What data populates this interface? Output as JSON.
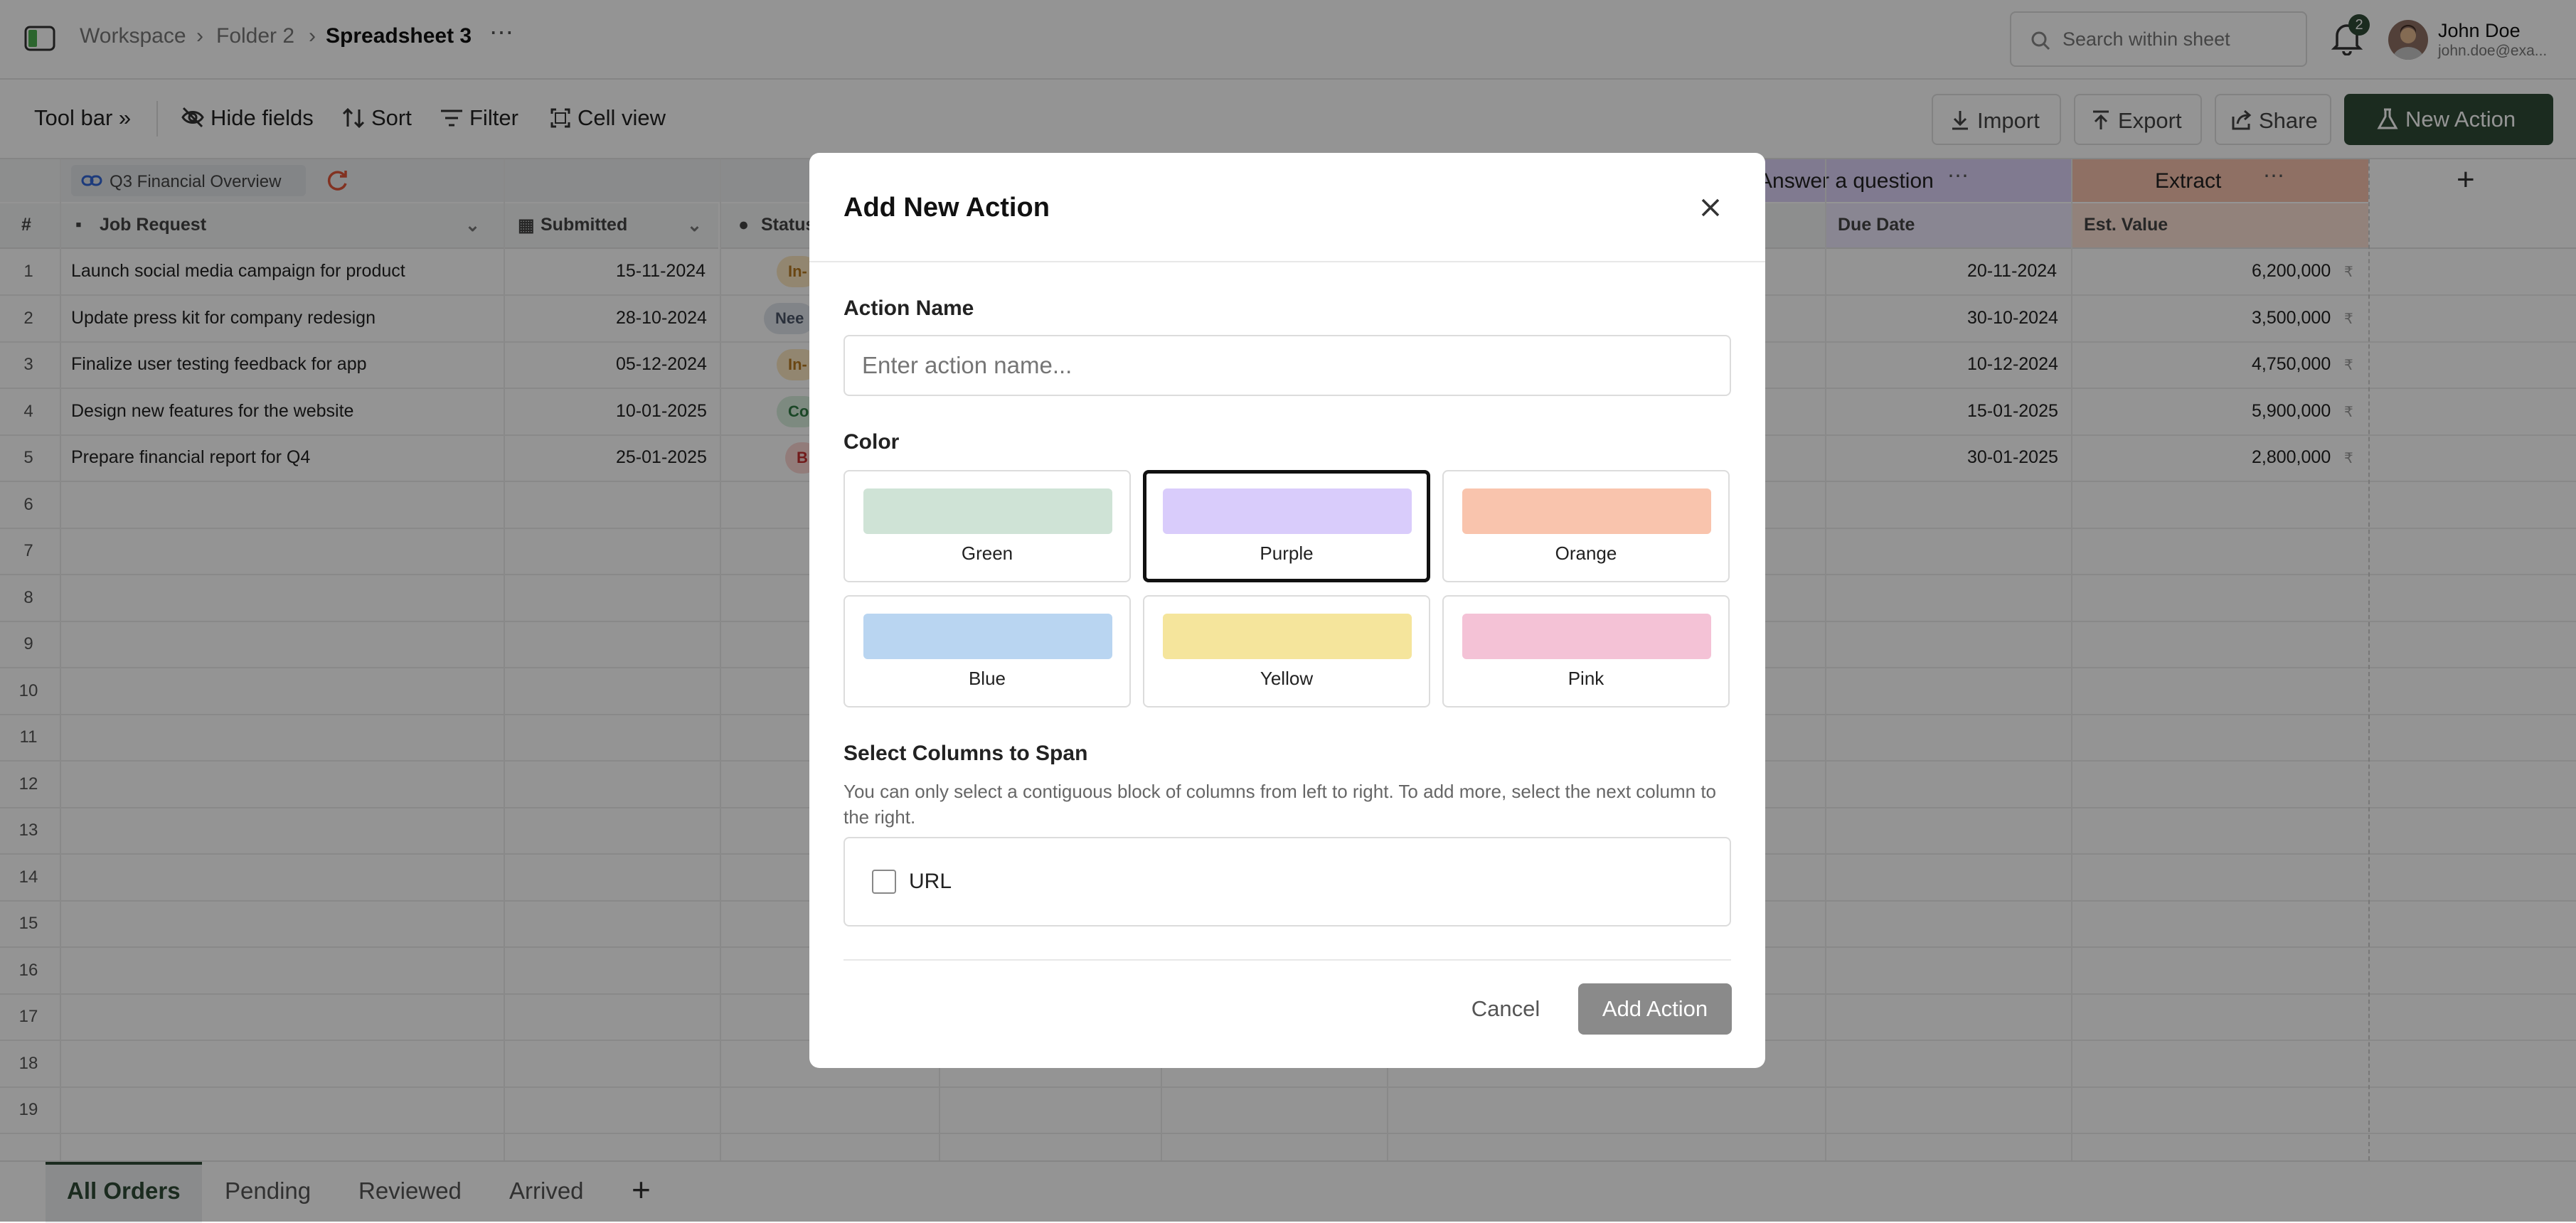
{
  "breadcrumb": {
    "workspace": "Workspace",
    "folder": "Folder 2",
    "sheet": "Spreadsheet 3"
  },
  "search": {
    "placeholder": "Search within sheet"
  },
  "notifications": {
    "count": "2"
  },
  "user": {
    "name": "John Doe",
    "email": "john.doe@exa..."
  },
  "toolbar": {
    "toolbar_label": "Tool bar",
    "hide_fields": "Hide fields",
    "sort": "Sort",
    "filter": "Filter",
    "cell_view": "Cell view",
    "import": "Import",
    "export": "Export",
    "share": "Share",
    "new_action": "New Action"
  },
  "grid": {
    "group_title": "Q3 Financial Overview",
    "group_answer": "Answer a question",
    "group_extract": "Extract",
    "columns": {
      "num": "#",
      "job_request": "Job Request",
      "submitted": "Submitted",
      "status": "Status",
      "due_date": "Due Date",
      "est_value": "Est. Value"
    },
    "rows": [
      {
        "n": "1",
        "job": "Launch social media campaign for product",
        "submitted": "15-11-2024",
        "status": "In-",
        "due": "20-11-2024",
        "value": "6,200,000"
      },
      {
        "n": "2",
        "job": "Update press kit for company redesign",
        "submitted": "28-10-2024",
        "status": "Nee",
        "due": "30-10-2024",
        "value": "3,500,000"
      },
      {
        "n": "3",
        "job": "Finalize user testing feedback for app",
        "submitted": "05-12-2024",
        "status": "In-",
        "due": "10-12-2024",
        "value": "4,750,000"
      },
      {
        "n": "4",
        "job": "Design new features for the website",
        "submitted": "10-01-2025",
        "status": "Co",
        "due": "15-01-2025",
        "value": "5,900,000"
      },
      {
        "n": "5",
        "job": "Prepare financial report for Q4",
        "submitted": "25-01-2025",
        "status": "B",
        "due": "30-01-2025",
        "value": "2,800,000"
      }
    ],
    "empty_rows": [
      "6",
      "7",
      "8",
      "9",
      "10",
      "11",
      "12",
      "13",
      "14",
      "15",
      "16",
      "17",
      "18",
      "19"
    ],
    "currency": "₹"
  },
  "tabs": [
    "All Orders",
    "Pending",
    "Reviewed",
    "Arrived"
  ],
  "modal": {
    "title": "Add New Action",
    "action_name_label": "Action Name",
    "action_name_placeholder": "Enter action name...",
    "color_label": "Color",
    "colors": [
      {
        "name": "Green",
        "hex": "#cfe3d6"
      },
      {
        "name": "Purple",
        "hex": "#d9ccfb"
      },
      {
        "name": "Orange",
        "hex": "#f9c4ad"
      },
      {
        "name": "Blue",
        "hex": "#b9d5f1"
      },
      {
        "name": "Yellow",
        "hex": "#f5e59c"
      },
      {
        "name": "Pink",
        "hex": "#f4c2d6"
      }
    ],
    "selected_color": "Purple",
    "columns_label": "Select Columns to Span",
    "columns_help": "You can only select a contiguous block of columns from left to right. To add more, select the next column to the right.",
    "column_option": "URL",
    "cancel": "Cancel",
    "add": "Add Action"
  }
}
